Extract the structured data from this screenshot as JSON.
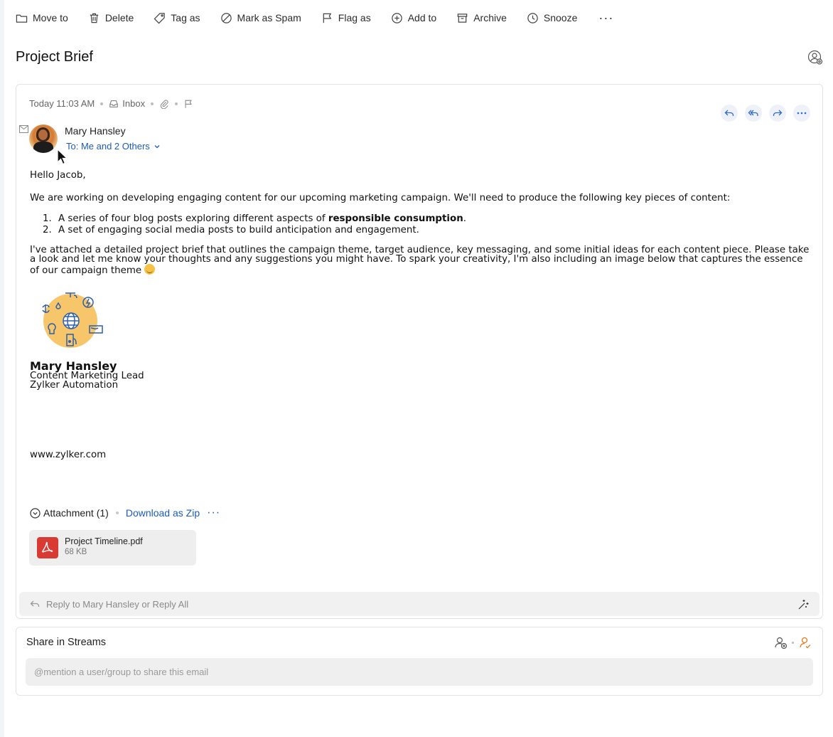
{
  "toolbar": {
    "move_to": "Move to",
    "delete": "Delete",
    "tag_as": "Tag as",
    "mark_as_spam": "Mark as Spam",
    "flag_as": "Flag as",
    "add_to": "Add to",
    "archive": "Archive",
    "snooze": "Snooze",
    "more": "···"
  },
  "email": {
    "subject": "Project Brief",
    "time": "Today 11:03 AM",
    "folder": "Inbox",
    "sender": "Mary Hansley",
    "recipients": "To: Me and 2 Others",
    "greeting": "Hello Jacob,",
    "intro": "We are working on developing engaging content for our upcoming marketing campaign. We'll need to produce the following key pieces of content:",
    "list": [
      {
        "num": "1.",
        "before": "A series of four blog posts exploring different aspects of ",
        "bold": "responsible consumption",
        "after": "."
      },
      {
        "num": "2.",
        "before": "A set of engaging social media posts to build anticipation and engagement.",
        "bold": "",
        "after": ""
      }
    ],
    "paragraph": "I've attached a detailed project brief that outlines the campaign theme, target audience, key messaging, and some initial ideas for each content piece. Please take a look and let me know your thoughts and any suggestions you might have. To spark your creativity, I'm also including an image below that captures the essence of our campaign theme",
    "signature": {
      "name": "Mary Hansley",
      "title": "Content Marketing Lead",
      "company": "Zylker Automation"
    },
    "website": "www.zylker.com"
  },
  "attachments": {
    "header": "Attachment (1)",
    "download_zip": "Download as Zip",
    "more": "···",
    "files": [
      {
        "name": "Project Timeline.pdf",
        "size": "68 KB"
      }
    ]
  },
  "reply_bar": {
    "text": "Reply to Mary Hansley or  Reply All"
  },
  "streams": {
    "title": "Share in Streams",
    "placeholder": "@mention a user/group to share this email"
  },
  "colors": {
    "link": "#1c5cb8",
    "pdf": "#d93a32",
    "action_bg": "#eef2f8",
    "illustration_circle": "#f7c66a",
    "accent_orange": "#e07a1f"
  }
}
